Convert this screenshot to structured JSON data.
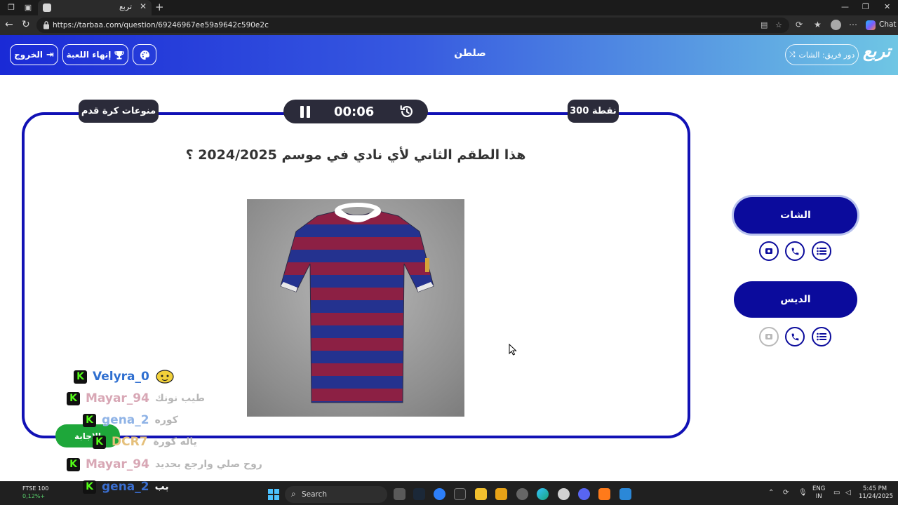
{
  "browser": {
    "tab_title": "تربع",
    "url": "https://tarbaa.com/question/69246967ee59a9642c590e2c",
    "chat_label": "Chat"
  },
  "header": {
    "exit_label": "الخروج",
    "end_game_label": "إنهاء اللعبة",
    "title": "صلطن",
    "turn_label": "دور فريق: الشات",
    "logo": "تربع"
  },
  "board": {
    "category": "منوعات كرة قدم",
    "timer": "00:06",
    "points": "300 نقطة",
    "question": "هذا الطقم الثاني لأي نادي في موسم 2024/2025 ؟",
    "answer_label": "الإجابة",
    "shirt_colors": [
      "#1f2f8c",
      "#8f1f42"
    ]
  },
  "teams": [
    {
      "name": "الشات",
      "active": true
    },
    {
      "name": "الديس",
      "active": false
    }
  ],
  "chat": [
    {
      "user": "Velyra_0",
      "message": "",
      "color": "#2f6fd0"
    },
    {
      "user": "Mayar_94",
      "message": "طيب نونك",
      "color": "#d8a7b5"
    },
    {
      "user": "gena_2",
      "message": "كوره",
      "color": "#8fb3e6"
    },
    {
      "user": "DCR7",
      "message": "ياله كورة",
      "color": "#e5c07b"
    },
    {
      "user": "Mayar_94",
      "message": "روح صلي وارجع بحديد",
      "color": "#d8a7b5"
    },
    {
      "user": "gena_2",
      "message": "بب",
      "color": "#3a6ed0"
    }
  ],
  "taskbar": {
    "ticker_name": "FTSE 100",
    "ticker_change": "0,12%+",
    "search_label": "Search",
    "lang_top": "ENG",
    "lang_bottom": "IN",
    "time": "5:45 PM",
    "date": "11/24/2025"
  }
}
